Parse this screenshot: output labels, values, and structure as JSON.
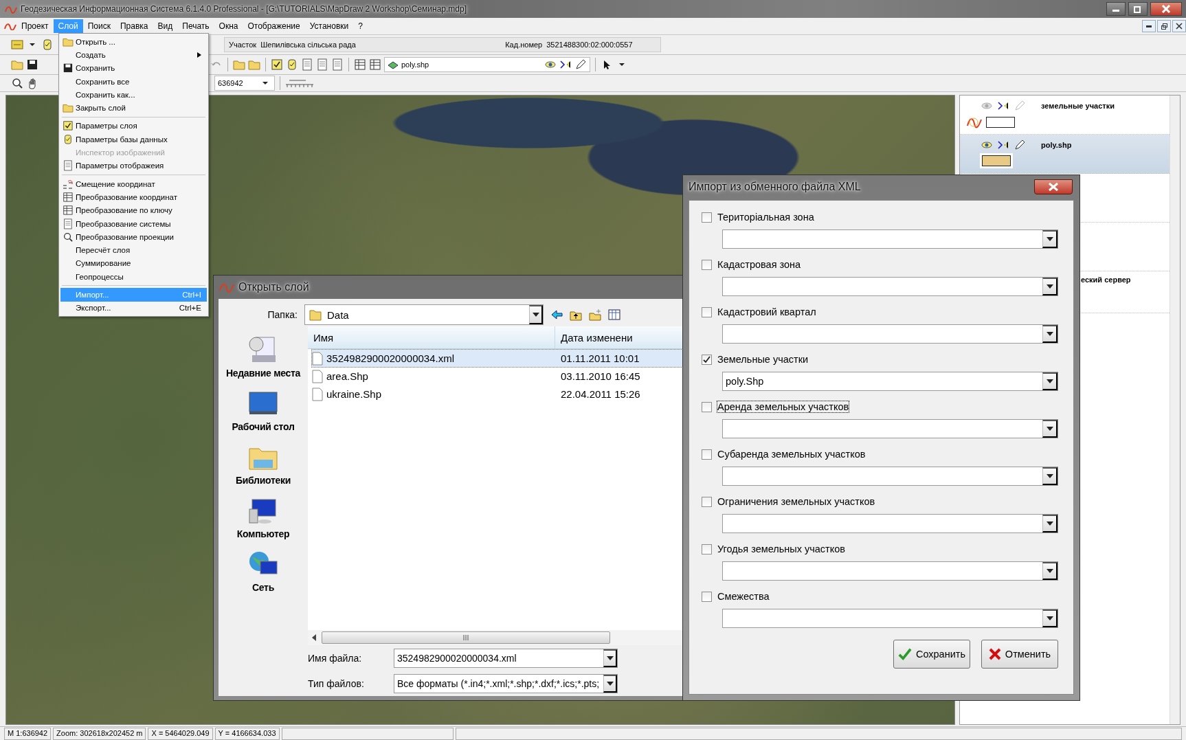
{
  "window": {
    "title": "Геодезическая Информационная Система 6.1.4.0 Professional - [G:\\TUTORIALS\\MapDraw 2 Workshop\\Семинар.mdp]"
  },
  "menu_bar": [
    {
      "label": "Проект",
      "selected": false
    },
    {
      "label": "Слой",
      "selected": true
    },
    {
      "label": "Поиск",
      "selected": false
    },
    {
      "label": "Правка",
      "selected": false
    },
    {
      "label": "Вид",
      "selected": false
    },
    {
      "label": "Печать",
      "selected": false
    },
    {
      "label": "Окна",
      "selected": false
    },
    {
      "label": "Отображение",
      "selected": false
    },
    {
      "label": "Установки",
      "selected": false
    },
    {
      "label": "?",
      "selected": false
    }
  ],
  "toolbar": {
    "parcel_label": "Участок",
    "parcel_value": "Шепилівська сільська рада",
    "cadastral_label": "Кад.номер",
    "cadastral_value": "3521488300:02:000:0557",
    "layer_combo": "poly.shp",
    "scale_combo": "636942"
  },
  "layer_menu": [
    {
      "kind": "item",
      "label": "Открыть ...",
      "selected": false,
      "disabled": false,
      "submenu": false
    },
    {
      "kind": "item",
      "label": "Создать",
      "selected": false,
      "disabled": false,
      "submenu": true
    },
    {
      "kind": "item",
      "label": "Сохранить",
      "selected": false,
      "disabled": false,
      "submenu": false
    },
    {
      "kind": "item",
      "label": "Сохранить все",
      "selected": false,
      "disabled": false,
      "submenu": false
    },
    {
      "kind": "item",
      "label": "Сохранить как...",
      "selected": false,
      "disabled": false,
      "submenu": false
    },
    {
      "kind": "item",
      "label": "Закрыть слой",
      "selected": false,
      "disabled": false,
      "submenu": false
    },
    {
      "kind": "separator"
    },
    {
      "kind": "item",
      "label": "Параметры слоя",
      "selected": false,
      "disabled": false,
      "submenu": false
    },
    {
      "kind": "item",
      "label": "Параметры базы данных",
      "selected": false,
      "disabled": false,
      "submenu": false
    },
    {
      "kind": "item",
      "label": "Инспектор изображений",
      "selected": false,
      "disabled": true,
      "submenu": false
    },
    {
      "kind": "item",
      "label": "Параметры отображеия",
      "selected": false,
      "disabled": false,
      "submenu": false
    },
    {
      "kind": "separator"
    },
    {
      "kind": "item",
      "label": "Смещение координат",
      "selected": false,
      "disabled": false,
      "submenu": false
    },
    {
      "kind": "item",
      "label": "Преобразование координат",
      "selected": false,
      "disabled": false,
      "submenu": false
    },
    {
      "kind": "item",
      "label": "Преобразование по ключу",
      "selected": false,
      "disabled": false,
      "submenu": false
    },
    {
      "kind": "item",
      "label": "Преобразование системы",
      "selected": false,
      "disabled": false,
      "submenu": false
    },
    {
      "kind": "item",
      "label": "Преобразование проекции",
      "selected": false,
      "disabled": false,
      "submenu": false
    },
    {
      "kind": "item",
      "label": "Пересчёт слоя",
      "selected": false,
      "disabled": false,
      "submenu": false
    },
    {
      "kind": "item",
      "label": "Суммирование",
      "selected": false,
      "disabled": false,
      "submenu": false
    },
    {
      "kind": "item",
      "label": "Геопроцессы",
      "selected": false,
      "disabled": false,
      "submenu": false
    },
    {
      "kind": "separator"
    },
    {
      "kind": "item",
      "label": "Импорт...",
      "shortcut": "Ctrl+I",
      "selected": true,
      "disabled": false,
      "submenu": false
    },
    {
      "kind": "item",
      "label": "Экспорт...",
      "shortcut": "Ctrl+E",
      "selected": false,
      "disabled": false,
      "submenu": false
    }
  ],
  "layers": [
    {
      "kind": "group",
      "name": "земельные участки",
      "selected": false,
      "visible": false,
      "color": "#ffffff"
    },
    {
      "kind": "layer",
      "name": "poly.shp",
      "selected": true,
      "visible": true,
      "color": "#e8c986"
    },
    {
      "kind": "covered",
      "name": "еский сервер",
      "selected": false
    }
  ],
  "open_dialog": {
    "title": "Открыть слой",
    "folder_label": "Папка:",
    "folder": "Data",
    "places": [
      "Недавние места",
      "Рабочий стол",
      "Библиотеки",
      "Компьютер",
      "Сеть"
    ],
    "columns": [
      "Имя",
      "Дата изменени"
    ],
    "files": [
      {
        "name": "3524982900020000034.xml",
        "date": "01.11.2011 10:01",
        "selected": true
      },
      {
        "name": "area.Shp",
        "date": "03.11.2010 16:45",
        "selected": false
      },
      {
        "name": "ukraine.Shp",
        "date": "22.04.2011 15:26",
        "selected": false
      }
    ],
    "filename_label": "Имя файла:",
    "filename": "3524982900020000034.xml",
    "filetype_label": "Тип файлов:",
    "filetype": "Все форматы (*.in4;*.xml;*.shp;*.dxf;*.ics;*.pts;"
  },
  "xml_dialog": {
    "title": "Импорт из обменного файла XML",
    "sections": [
      {
        "label": "Територіальная зона",
        "checked": false,
        "focused": false
      },
      {
        "label": "Кадастровая зона",
        "checked": false,
        "focused": false
      },
      {
        "label": "Кадастровий квартал",
        "checked": false,
        "focused": false
      },
      {
        "label": "Земельные участки",
        "checked": true,
        "focused": false,
        "value": "poly.Shp"
      },
      {
        "label": "Аренда земельных участков",
        "checked": false,
        "focused": true
      },
      {
        "label": "Субаренда земельных участков",
        "checked": false,
        "focused": false
      },
      {
        "label": "Ограничения земельных участков",
        "checked": false,
        "focused": false
      },
      {
        "label": "Угодья земельных участков",
        "checked": false,
        "focused": false
      },
      {
        "label": "Смежества",
        "checked": false,
        "focused": false
      }
    ],
    "buttons": [
      {
        "kind": "save",
        "label": "Сохранить"
      },
      {
        "kind": "cancel",
        "label": "Отменить"
      }
    ]
  },
  "status_bar": [
    "M 1:636942",
    "Zoom: 302618x202452 m",
    "X = 5464029.049",
    "Y = 4166634.033"
  ]
}
